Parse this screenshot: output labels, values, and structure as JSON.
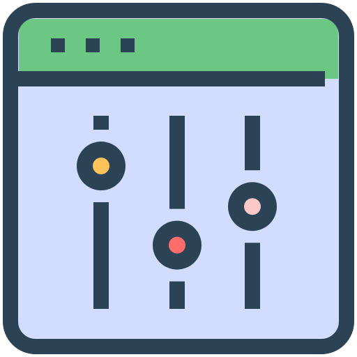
{
  "icon": {
    "name": "equalizer-window-icon",
    "window": {
      "control_dot_count": 3
    },
    "sliders": [
      {
        "name": "slider-left",
        "knob_color": "#FFC35A",
        "level": 0.74
      },
      {
        "name": "slider-middle",
        "knob_color": "#FF6E6A",
        "level": 0.33
      },
      {
        "name": "slider-right",
        "knob_color": "#FFC8C8",
        "level": 0.53
      }
    ]
  },
  "colors": {
    "outline": "#2C4356",
    "title_bar": "#6CC785",
    "content_background": "#D2DCFF",
    "frame_background": "#FFFFFF"
  }
}
